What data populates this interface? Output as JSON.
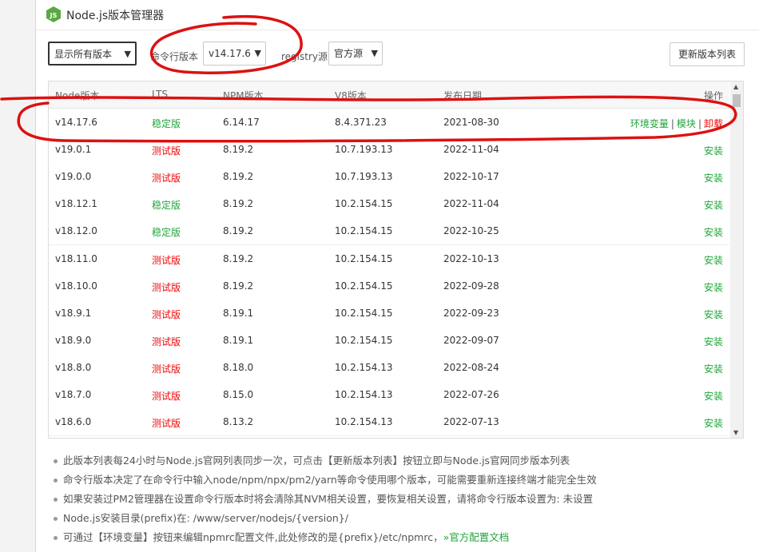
{
  "window": {
    "title": "Node.js版本管理器",
    "logo_text": "JS"
  },
  "toolbar": {
    "filter_select": "显示所有版本",
    "cmd_version_label": "命令行版本",
    "cmd_version_select": "v14.17.6",
    "registry_label": "registry源",
    "registry_select": "官方源",
    "update_button": "更新版本列表"
  },
  "table": {
    "headers": {
      "version": "Node版本",
      "lts": "LTS",
      "npm": "NPM版本",
      "v8": "V8版本",
      "date": "发布日期",
      "op": "操作"
    },
    "installed_ops": {
      "env": "环境变量",
      "sep": "|",
      "modules": "模块",
      "uninstall": "卸载"
    },
    "install_label": "安装",
    "rows": [
      {
        "version": "v14.17.6",
        "lts": "稳定版",
        "npm": "6.14.17",
        "v8": "8.4.371.23",
        "date": "2021-08-30",
        "installed": true
      },
      {
        "version": "v19.0.1",
        "lts": "测试版",
        "npm": "8.19.2",
        "v8": "10.7.193.13",
        "date": "2022-11-04",
        "installed": false
      },
      {
        "version": "v19.0.0",
        "lts": "测试版",
        "npm": "8.19.2",
        "v8": "10.7.193.13",
        "date": "2022-10-17",
        "installed": false
      },
      {
        "version": "v18.12.1",
        "lts": "稳定版",
        "npm": "8.19.2",
        "v8": "10.2.154.15",
        "date": "2022-11-04",
        "installed": false
      },
      {
        "version": "v18.12.0",
        "lts": "稳定版",
        "npm": "8.19.2",
        "v8": "10.2.154.15",
        "date": "2022-10-25",
        "installed": false
      },
      {
        "version": "v18.11.0",
        "lts": "测试版",
        "npm": "8.19.2",
        "v8": "10.2.154.15",
        "date": "2022-10-13",
        "installed": false
      },
      {
        "version": "v18.10.0",
        "lts": "测试版",
        "npm": "8.19.2",
        "v8": "10.2.154.15",
        "date": "2022-09-28",
        "installed": false
      },
      {
        "version": "v18.9.1",
        "lts": "测试版",
        "npm": "8.19.1",
        "v8": "10.2.154.15",
        "date": "2022-09-23",
        "installed": false
      },
      {
        "version": "v18.9.0",
        "lts": "测试版",
        "npm": "8.19.1",
        "v8": "10.2.154.15",
        "date": "2022-09-07",
        "installed": false
      },
      {
        "version": "v18.8.0",
        "lts": "测试版",
        "npm": "8.18.0",
        "v8": "10.2.154.13",
        "date": "2022-08-24",
        "installed": false
      },
      {
        "version": "v18.7.0",
        "lts": "测试版",
        "npm": "8.15.0",
        "v8": "10.2.154.13",
        "date": "2022-07-26",
        "installed": false
      },
      {
        "version": "v18.6.0",
        "lts": "测试版",
        "npm": "8.13.2",
        "v8": "10.2.154.13",
        "date": "2022-07-13",
        "installed": false
      }
    ]
  },
  "notes": {
    "n1": "此版本列表每24小时与Node.js官网列表同步一次，可点击【更新版本列表】按钮立即与Node.js官网同步版本列表",
    "n2": "命令行版本决定了在命令行中输入node/npm/npx/pm2/yarn等命令使用哪个版本，可能需要重新连接终端才能完全生效",
    "n3": "如果安装过PM2管理器在设置命令行版本时将会清除其NVM相关设置，要恢复相关设置，请将命令行版本设置为: 未设置",
    "n4": "Node.js安装目录(prefix)在: /www/server/nodejs/{version}/",
    "n5": "可通过【环境变量】按钮来编辑npmrc配置文件,此处修改的是{prefix}/etc/npmrc，",
    "n5_link": "»官方配置文档"
  },
  "colors": {
    "brand_green": "#20a53a",
    "test_red": "#ef0808",
    "annotation_red": "#dd1111"
  }
}
